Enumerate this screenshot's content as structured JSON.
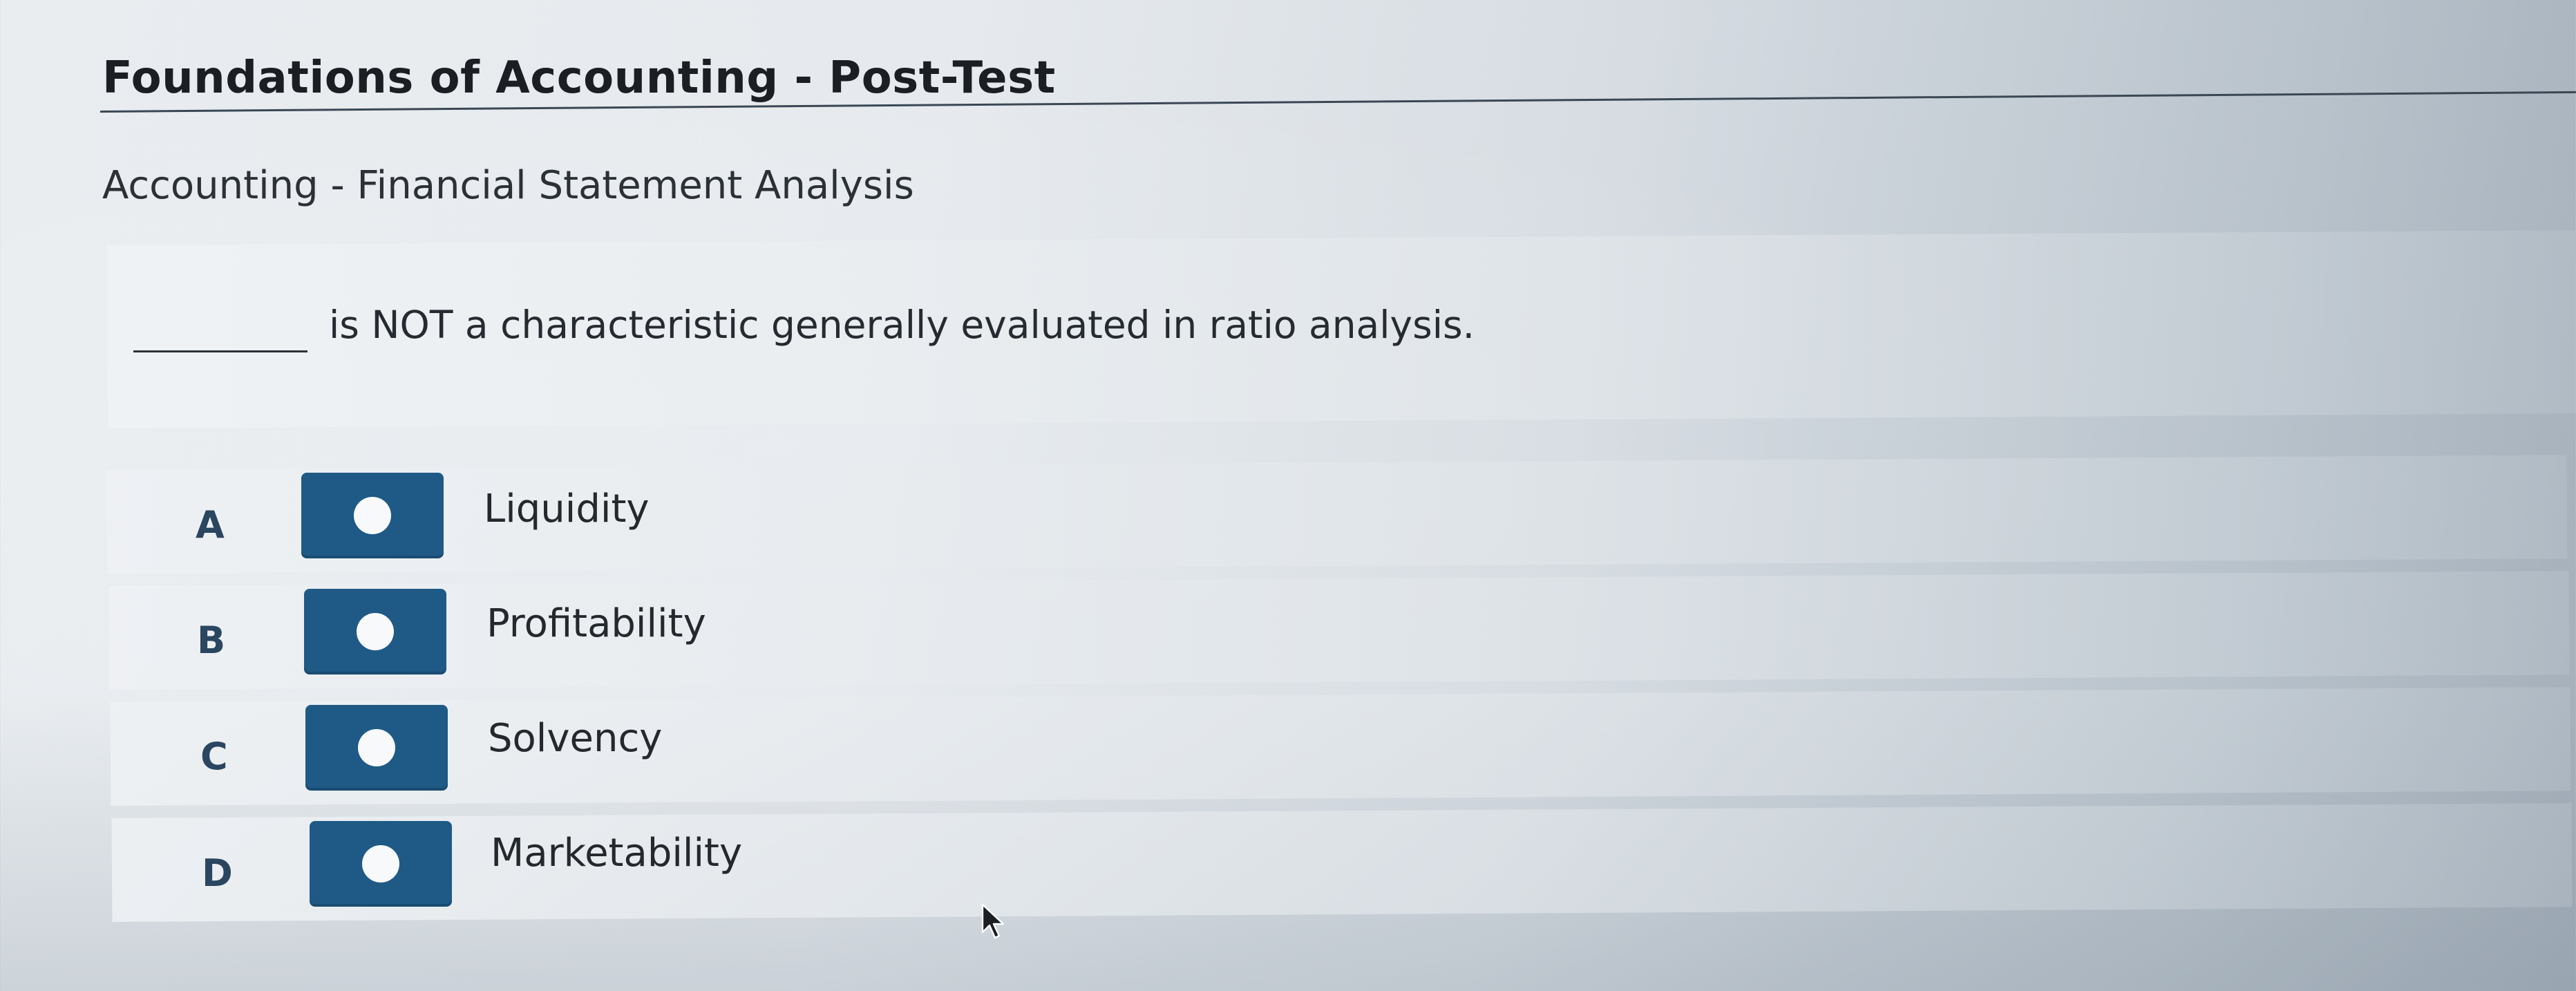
{
  "header": {
    "title": "Foundations of Accounting - Post-Test"
  },
  "subtitle": "Accounting - Financial Statement Analysis",
  "question": {
    "blank": "________",
    "text": "is NOT a characteristic generally evaluated in ratio analysis."
  },
  "options": [
    {
      "letter": "A",
      "label": "Liquidity"
    },
    {
      "letter": "B",
      "label": "Profitability"
    },
    {
      "letter": "C",
      "label": "Solvency"
    },
    {
      "letter": "D",
      "label": "Marketability"
    }
  ],
  "colors": {
    "radio_button": "#1f5a86",
    "radio_dot": "#f7f9fb",
    "letter": "#2a4660"
  },
  "icons": {
    "cursor": "mouse-pointer-arrow"
  }
}
